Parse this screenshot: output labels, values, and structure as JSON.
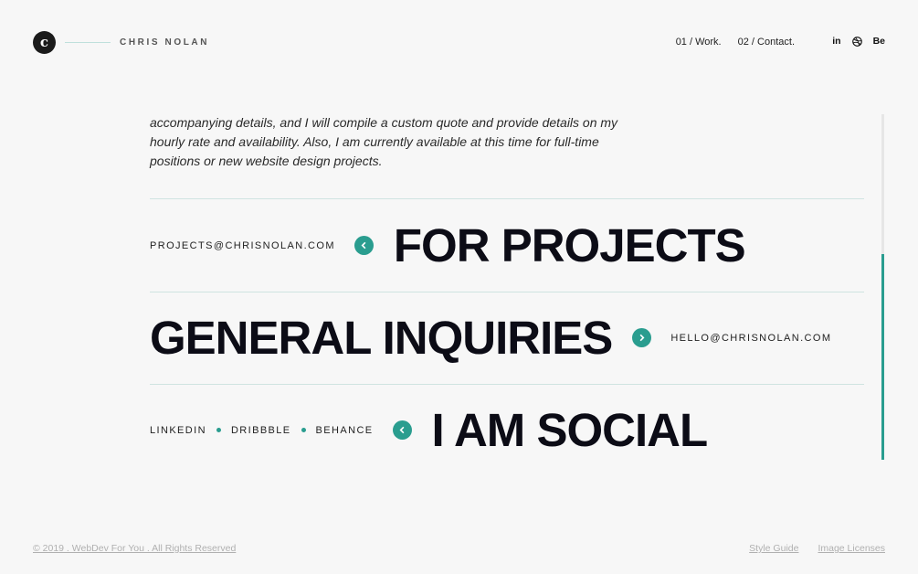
{
  "header": {
    "logo_letter": "c",
    "brand_name": "CHRIS NOLAN",
    "nav": [
      {
        "label": "01 / Work."
      },
      {
        "label": "02 / Contact."
      }
    ],
    "social": {
      "linkedin": "in",
      "behance": "Be"
    }
  },
  "intro": "accompanying details, and I will compile a custom quote and provide details on my hourly rate and availability. Also, I am currently available at this time for full-time positions or new website design projects.",
  "contact_rows": {
    "projects": {
      "email": "PROJECTS@CHRISNOLAN.COM",
      "heading": "FOR PROJECTS"
    },
    "inquiries": {
      "heading": "GENERAL INQUIRIES",
      "email": "HELLO@CHRISNOLAN.COM"
    },
    "social": {
      "links": [
        "LINKEDIN",
        "DRIBBBLE",
        "BEHANCE"
      ],
      "heading": "I AM SOCIAL"
    }
  },
  "footer": {
    "copyright": "© 2019 . WebDev For You . All Rights Reserved",
    "links": [
      "Style Guide",
      "Image Licenses"
    ]
  },
  "colors": {
    "accent": "#2a9d8f",
    "background": "#f7f7f7",
    "heading": "#0c0c16"
  }
}
